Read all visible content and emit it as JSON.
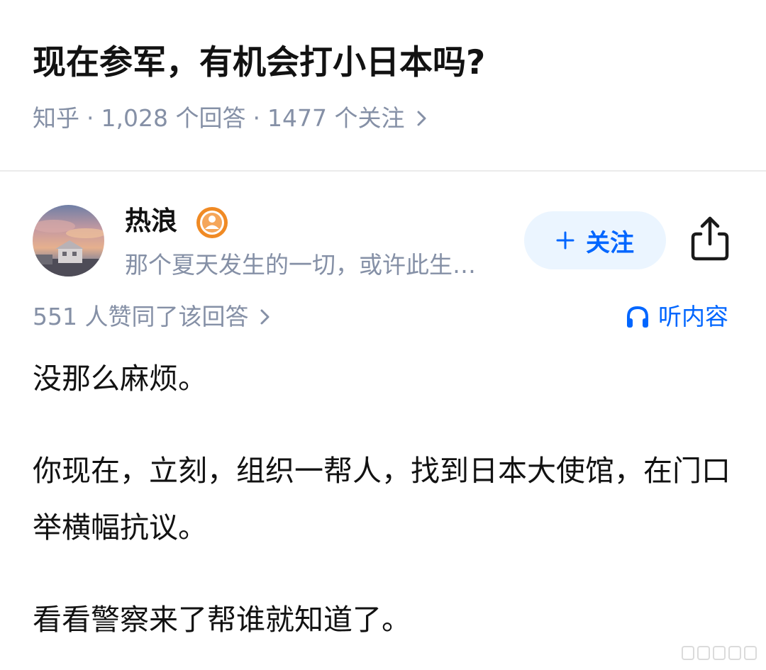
{
  "question": {
    "title": "现在参军，有机会打小日本吗?",
    "source": "知乎",
    "answers": "1,028 个回答",
    "followers": "1477 个关注"
  },
  "author": {
    "name": "热浪",
    "bio": "那个夏天发生的一切，或许此生…",
    "badge_icon": "user-badge-icon"
  },
  "actions": {
    "follow_label": "关注",
    "share_icon": "share-icon"
  },
  "answer": {
    "votes": "551 人赞同了该回答",
    "listen_label": "听内容",
    "paragraphs": [
      "没那么麻烦。",
      "你现在，立刻，组织一帮人，找到日本大使馆，在门口举横幅抗议。",
      "看看警察来了帮谁就知道了。"
    ]
  },
  "colors": {
    "accent": "#0066ff",
    "meta": "#8590a6",
    "follow_bg": "#ebf5ff",
    "badge": "#f08a24"
  }
}
